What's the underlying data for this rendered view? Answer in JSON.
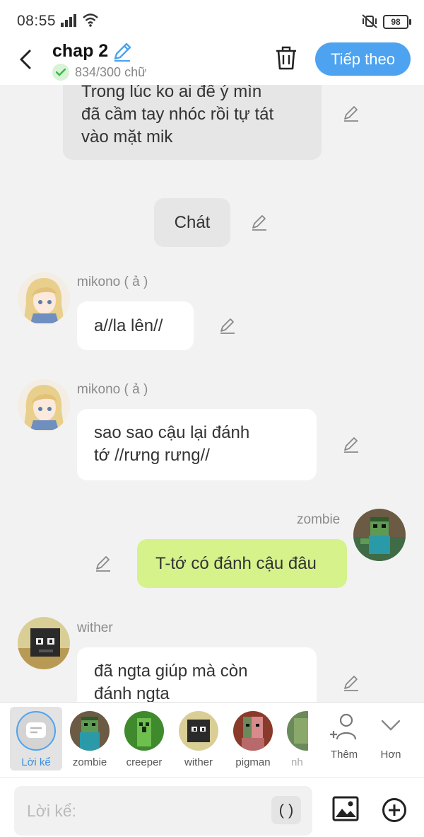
{
  "status": {
    "time": "08:55",
    "battery": "98"
  },
  "header": {
    "title": "chap 2",
    "word_count": "834/300 chữ",
    "next_label": "Tiếp theo"
  },
  "messages": {
    "narr1": {
      "line1": "Trong lúc ko ai để ý mìn",
      "line2": "đã cầm tay nhóc rồi tự tát",
      "line3": "vào mặt mik"
    },
    "narr2": {
      "text": "Chát"
    },
    "msg1": {
      "name": "mikono ( ả )",
      "text": "a//la lên//"
    },
    "msg2": {
      "name": "mikono ( ả )",
      "line1": "sao sao cậu lại đánh",
      "line2": "tớ //rưng rưng//"
    },
    "msg3": {
      "name": "zombie",
      "text": "T-tớ có đánh cậu đâu"
    },
    "msg4": {
      "name": "wither",
      "line1": "đã ngta giúp mà còn",
      "line2": "đánh ngta"
    }
  },
  "characters": [
    {
      "label": "Lời kể"
    },
    {
      "label": "zombie"
    },
    {
      "label": "creeper"
    },
    {
      "label": "wither"
    },
    {
      "label": "pigman"
    },
    {
      "label": "nh"
    }
  ],
  "actions": {
    "add_label": "Thêm",
    "more_label": "Hơn"
  },
  "input": {
    "placeholder": "Lời kể:",
    "paren": "( )"
  },
  "colors": {
    "accent": "#4da3f0",
    "green_bubble": "#d5f28b",
    "narration_bubble": "#e6e6e6"
  }
}
